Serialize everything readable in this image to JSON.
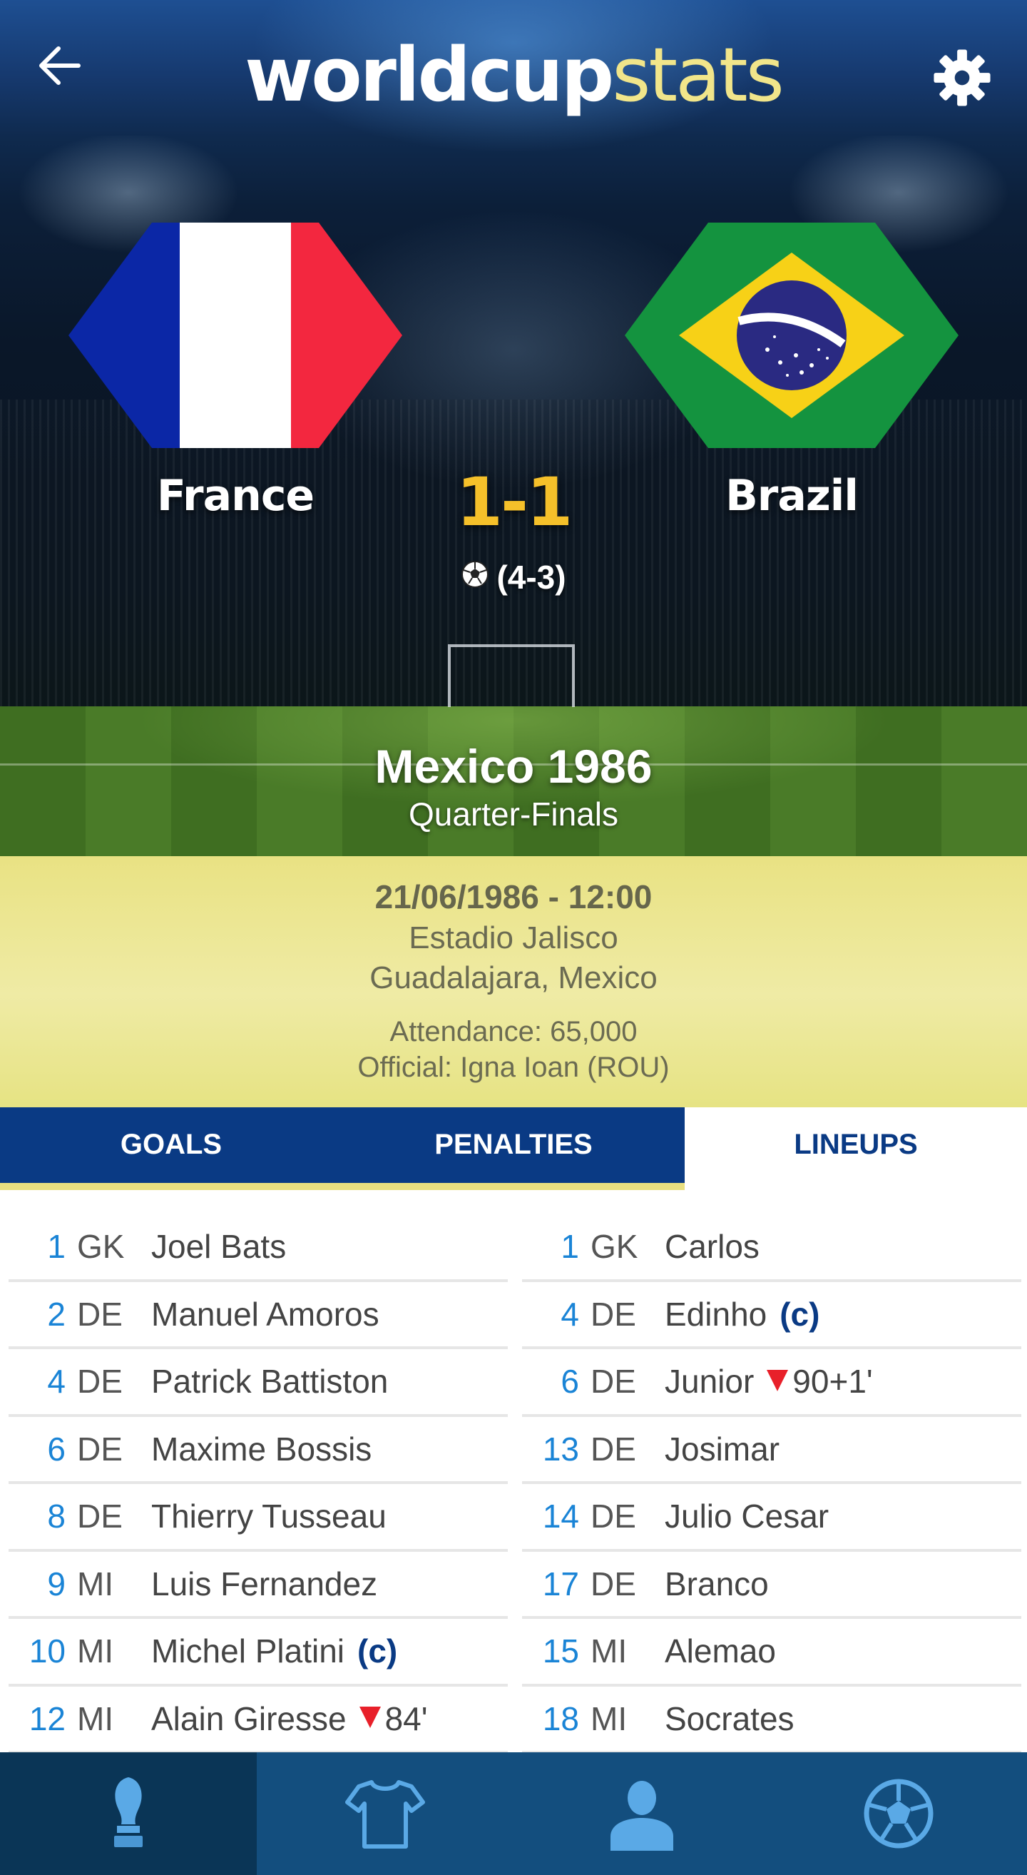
{
  "header": {
    "logo_primary": "worldcup",
    "logo_secondary": "stats",
    "back_icon": "back-arrow-icon",
    "settings_icon": "gear-icon"
  },
  "match": {
    "home_team": "France",
    "away_team": "Brazil",
    "score": "1-1",
    "penalty_score": "(4-3)",
    "edition": "Mexico 1986",
    "stage": "Quarter-Finals",
    "date_time": "21/06/1986 - 12:00",
    "stadium": "Estadio Jalisco",
    "city": "Guadalajara, Mexico",
    "attendance": "Attendance: 65,000",
    "official": "Official: Igna Ioan (ROU)"
  },
  "colors": {
    "primary_blue": "#0a3a84",
    "accent_yellow": "#e9df80",
    "score_gold": "#f5c02a",
    "shirt_number_blue": "#1a84d6",
    "sub_red": "#e8202a"
  },
  "tabs": [
    {
      "label": "GOALS",
      "active": false
    },
    {
      "label": "PENALTIES",
      "active": false
    },
    {
      "label": "LINEUPS",
      "active": true
    }
  ],
  "lineups": {
    "home": [
      {
        "num": "1",
        "pos": "GK",
        "name": "Joel Bats",
        "captain": "",
        "sub": ""
      },
      {
        "num": "2",
        "pos": "DE",
        "name": "Manuel Amoros",
        "captain": "",
        "sub": ""
      },
      {
        "num": "4",
        "pos": "DE",
        "name": "Patrick Battiston",
        "captain": "",
        "sub": ""
      },
      {
        "num": "6",
        "pos": "DE",
        "name": "Maxime Bossis",
        "captain": "",
        "sub": ""
      },
      {
        "num": "8",
        "pos": "DE",
        "name": "Thierry Tusseau",
        "captain": "",
        "sub": ""
      },
      {
        "num": "9",
        "pos": "MI",
        "name": "Luis Fernandez",
        "captain": "",
        "sub": ""
      },
      {
        "num": "10",
        "pos": "MI",
        "name": "Michel Platini",
        "captain": "(c)",
        "sub": ""
      },
      {
        "num": "12",
        "pos": "MI",
        "name": "Alain Giresse",
        "captain": "",
        "sub": "84'"
      }
    ],
    "away": [
      {
        "num": "1",
        "pos": "GK",
        "name": "Carlos",
        "captain": "",
        "sub": ""
      },
      {
        "num": "4",
        "pos": "DE",
        "name": "Edinho",
        "captain": "(c)",
        "sub": ""
      },
      {
        "num": "6",
        "pos": "DE",
        "name": "Junior",
        "captain": "",
        "sub": "90+1'"
      },
      {
        "num": "13",
        "pos": "DE",
        "name": "Josimar",
        "captain": "",
        "sub": ""
      },
      {
        "num": "14",
        "pos": "DE",
        "name": "Julio Cesar",
        "captain": "",
        "sub": ""
      },
      {
        "num": "17",
        "pos": "DE",
        "name": "Branco",
        "captain": "",
        "sub": ""
      },
      {
        "num": "15",
        "pos": "MI",
        "name": "Alemao",
        "captain": "",
        "sub": ""
      },
      {
        "num": "18",
        "pos": "MI",
        "name": "Socrates",
        "captain": "",
        "sub": ""
      }
    ]
  },
  "bottom_nav": [
    {
      "icon": "trophy-icon",
      "active": true
    },
    {
      "icon": "jersey-icon",
      "active": false
    },
    {
      "icon": "player-icon",
      "active": false
    },
    {
      "icon": "football-icon",
      "active": false
    }
  ]
}
